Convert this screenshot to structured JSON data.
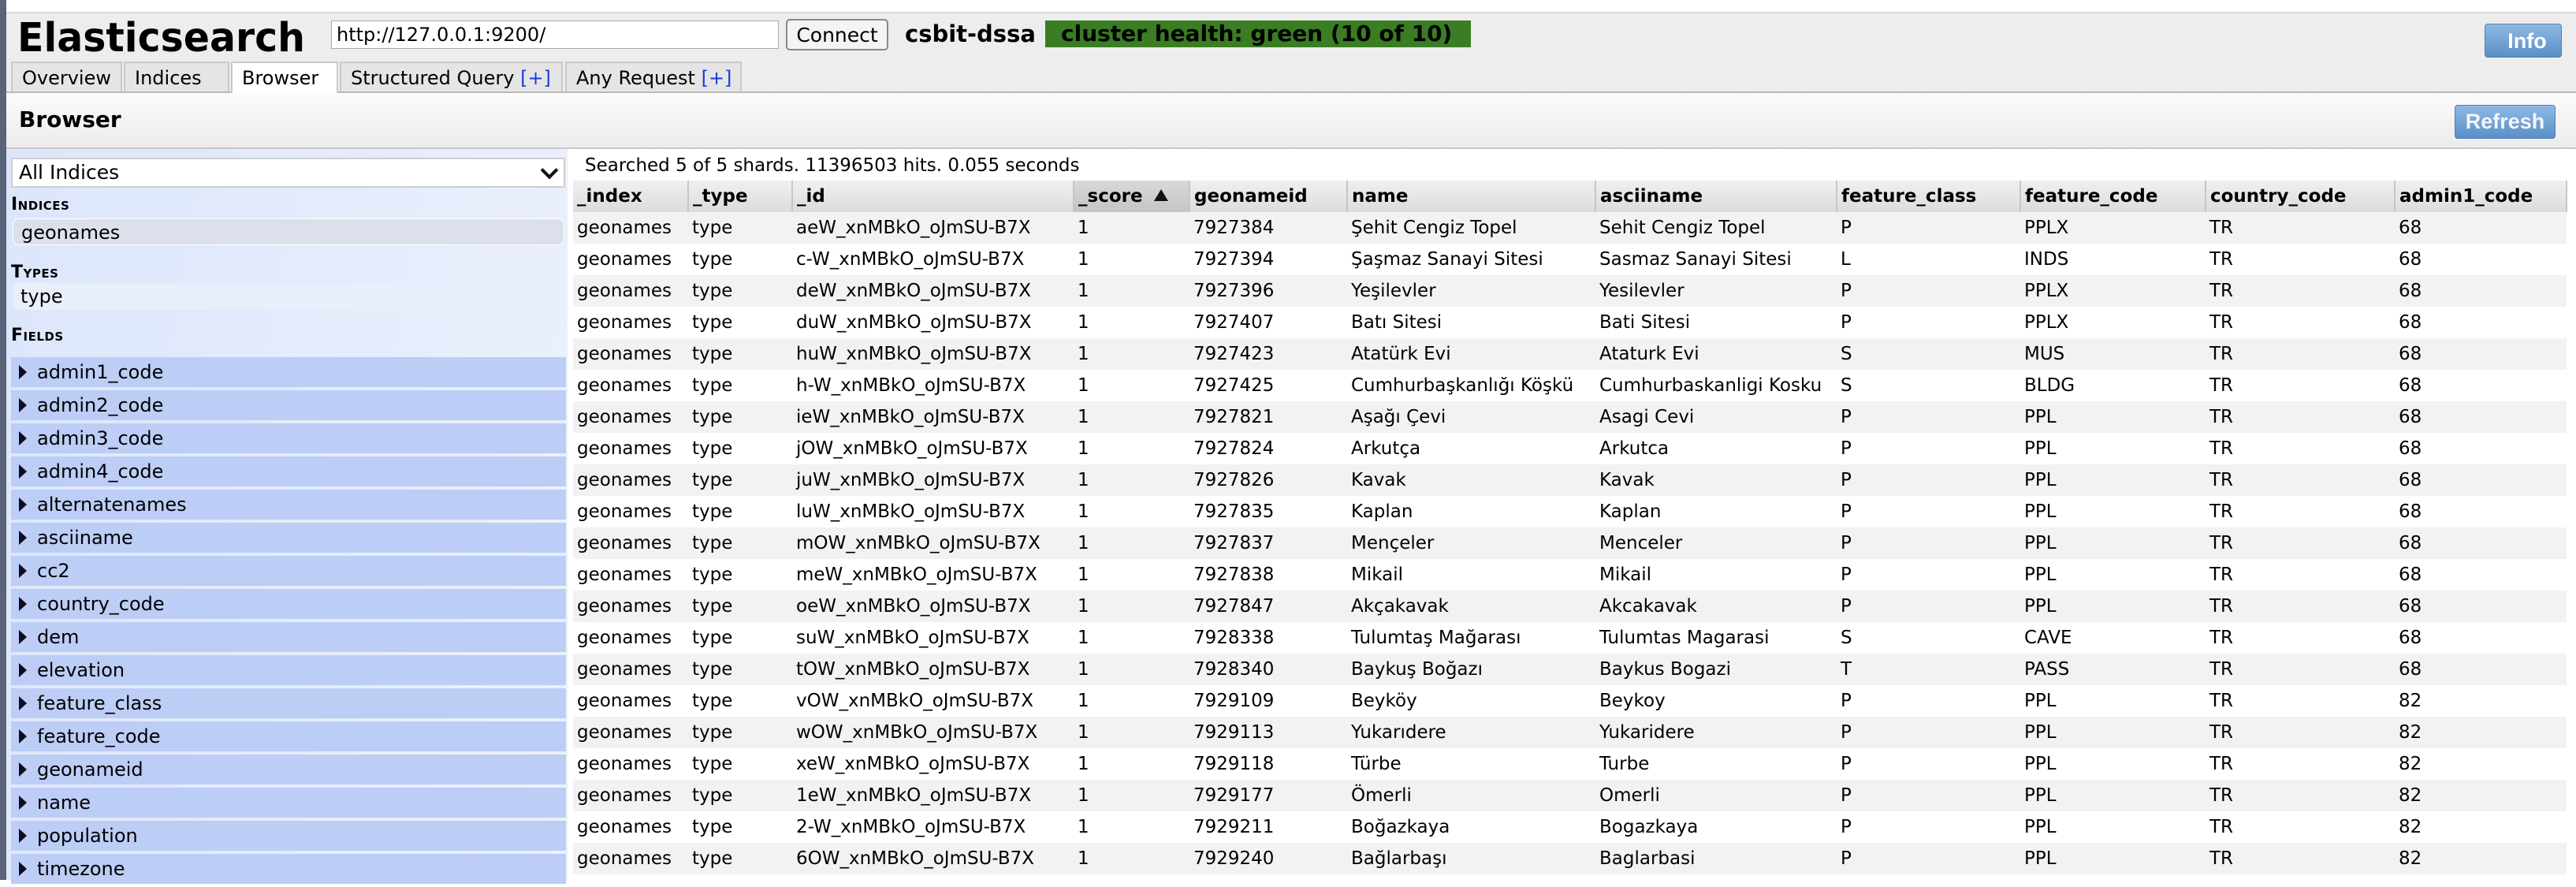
{
  "header": {
    "app_title": "Elasticsearch",
    "url_value": "http://127.0.0.1:9200/",
    "connect_label": "Connect",
    "cluster_name": "csbit-dssa",
    "cluster_health": "cluster health: green (10 of 10)",
    "health_color": "#3a7d23",
    "info_label": "Info"
  },
  "tabs": [
    {
      "label": "Overview",
      "plus": ""
    },
    {
      "label": "Indices",
      "plus": ""
    },
    {
      "label": "Browser",
      "plus": "",
      "active": true
    },
    {
      "label": "Structured Query ",
      "plus": "[+]"
    },
    {
      "label": "Any Request ",
      "plus": "[+]"
    }
  ],
  "browser": {
    "title": "Browser",
    "refresh_label": "Refresh"
  },
  "sidebar": {
    "index_select": "All Indices",
    "indices_label": "Indices",
    "indices": [
      "geonames"
    ],
    "types_label": "Types",
    "types": [
      "type"
    ],
    "fields_label": "Fields",
    "fields": [
      "admin1_code",
      "admin2_code",
      "admin3_code",
      "admin4_code",
      "alternatenames",
      "asciiname",
      "cc2",
      "country_code",
      "dem",
      "elevation",
      "feature_class",
      "feature_code",
      "geonameid",
      "name",
      "population",
      "timezone"
    ]
  },
  "results": {
    "summary": "Searched 5 of 5 shards. 11396503 hits. 0.055 seconds",
    "sorted_column": "_score",
    "columns": [
      "_index",
      "_type",
      "_id",
      "_score",
      "geonameid",
      "name",
      "asciiname",
      "feature_class",
      "feature_code",
      "country_code",
      "admin1_code"
    ],
    "rows": [
      [
        "geonames",
        "type",
        "aeW_xnMBkO_oJmSU-B7X",
        "1",
        "7927384",
        "Şehit Cengiz Topel",
        "Sehit Cengiz Topel",
        "P",
        "PPLX",
        "TR",
        "68"
      ],
      [
        "geonames",
        "type",
        "c-W_xnMBkO_oJmSU-B7X",
        "1",
        "7927394",
        "Şaşmaz Sanayi Sitesi",
        "Sasmaz Sanayi Sitesi",
        "L",
        "INDS",
        "TR",
        "68"
      ],
      [
        "geonames",
        "type",
        "deW_xnMBkO_oJmSU-B7X",
        "1",
        "7927396",
        "Yeşilevler",
        "Yesilevler",
        "P",
        "PPLX",
        "TR",
        "68"
      ],
      [
        "geonames",
        "type",
        "duW_xnMBkO_oJmSU-B7X",
        "1",
        "7927407",
        "Batı Sitesi",
        "Bati Sitesi",
        "P",
        "PPLX",
        "TR",
        "68"
      ],
      [
        "geonames",
        "type",
        "huW_xnMBkO_oJmSU-B7X",
        "1",
        "7927423",
        "Atatürk Evi",
        "Ataturk Evi",
        "S",
        "MUS",
        "TR",
        "68"
      ],
      [
        "geonames",
        "type",
        "h-W_xnMBkO_oJmSU-B7X",
        "1",
        "7927425",
        "Cumhurbaşkanlığı Köşkü",
        "Cumhurbaskanligi Kosku",
        "S",
        "BLDG",
        "TR",
        "68"
      ],
      [
        "geonames",
        "type",
        "ieW_xnMBkO_oJmSU-B7X",
        "1",
        "7927821",
        "Aşağı Çevi",
        "Asagi Cevi",
        "P",
        "PPL",
        "TR",
        "68"
      ],
      [
        "geonames",
        "type",
        "jOW_xnMBkO_oJmSU-B7X",
        "1",
        "7927824",
        "Arkutça",
        "Arkutca",
        "P",
        "PPL",
        "TR",
        "68"
      ],
      [
        "geonames",
        "type",
        "juW_xnMBkO_oJmSU-B7X",
        "1",
        "7927826",
        "Kavak",
        "Kavak",
        "P",
        "PPL",
        "TR",
        "68"
      ],
      [
        "geonames",
        "type",
        "luW_xnMBkO_oJmSU-B7X",
        "1",
        "7927835",
        "Kaplan",
        "Kaplan",
        "P",
        "PPL",
        "TR",
        "68"
      ],
      [
        "geonames",
        "type",
        "mOW_xnMBkO_oJmSU-B7X",
        "1",
        "7927837",
        "Mençeler",
        "Menceler",
        "P",
        "PPL",
        "TR",
        "68"
      ],
      [
        "geonames",
        "type",
        "meW_xnMBkO_oJmSU-B7X",
        "1",
        "7927838",
        "Mikail",
        "Mikail",
        "P",
        "PPL",
        "TR",
        "68"
      ],
      [
        "geonames",
        "type",
        "oeW_xnMBkO_oJmSU-B7X",
        "1",
        "7927847",
        "Akçakavak",
        "Akcakavak",
        "P",
        "PPL",
        "TR",
        "68"
      ],
      [
        "geonames",
        "type",
        "suW_xnMBkO_oJmSU-B7X",
        "1",
        "7928338",
        "Tulumtaş Mağarası",
        "Tulumtas Magarasi",
        "S",
        "CAVE",
        "TR",
        "68"
      ],
      [
        "geonames",
        "type",
        "tOW_xnMBkO_oJmSU-B7X",
        "1",
        "7928340",
        "Baykuş Boğazı",
        "Baykus Bogazi",
        "T",
        "PASS",
        "TR",
        "68"
      ],
      [
        "geonames",
        "type",
        "vOW_xnMBkO_oJmSU-B7X",
        "1",
        "7929109",
        "Beyköy",
        "Beykoy",
        "P",
        "PPL",
        "TR",
        "82"
      ],
      [
        "geonames",
        "type",
        "wOW_xnMBkO_oJmSU-B7X",
        "1",
        "7929113",
        "Yukarıdere",
        "Yukaridere",
        "P",
        "PPL",
        "TR",
        "82"
      ],
      [
        "geonames",
        "type",
        "xeW_xnMBkO_oJmSU-B7X",
        "1",
        "7929118",
        "Türbe",
        "Turbe",
        "P",
        "PPL",
        "TR",
        "82"
      ],
      [
        "geonames",
        "type",
        "1eW_xnMBkO_oJmSU-B7X",
        "1",
        "7929177",
        "Ömerli",
        "Omerli",
        "P",
        "PPL",
        "TR",
        "82"
      ],
      [
        "geonames",
        "type",
        "2-W_xnMBkO_oJmSU-B7X",
        "1",
        "7929211",
        "Boğazkaya",
        "Bogazkaya",
        "P",
        "PPL",
        "TR",
        "82"
      ],
      [
        "geonames",
        "type",
        "6OW_xnMBkO_oJmSU-B7X",
        "1",
        "7929240",
        "Bağlarbaşı",
        "Baglarbasi",
        "P",
        "PPL",
        "TR",
        "82"
      ]
    ]
  }
}
